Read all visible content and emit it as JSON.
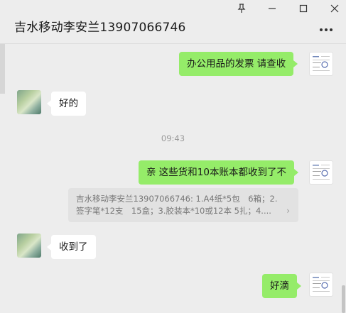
{
  "window": {
    "title": "吉水移动李安兰13907066746",
    "pin_icon": "pin-icon",
    "minimize_icon": "minimize-icon",
    "maximize_icon": "maximize-icon",
    "close_icon": "close-icon",
    "more_icon": "more-options-icon"
  },
  "messages": [
    {
      "side": "me",
      "text": "办公用品的发票 请查收"
    },
    {
      "side": "other",
      "text": "好的"
    },
    {
      "time": "09:43"
    },
    {
      "side": "me",
      "text": "亲 这些货和10本账本都收到了不"
    },
    {
      "quote": "吉水移动李安兰13907066746: 1.A4纸*5包　6箱；2.签字笔*12支　15盒；3.胶装本*10或12本 5扎；4...."
    },
    {
      "side": "other",
      "text": "收到了"
    },
    {
      "side": "me",
      "text": "好滴"
    }
  ],
  "colors": {
    "background": "#ededed",
    "my_bubble": "#95ec69",
    "other_bubble": "#ffffff"
  }
}
